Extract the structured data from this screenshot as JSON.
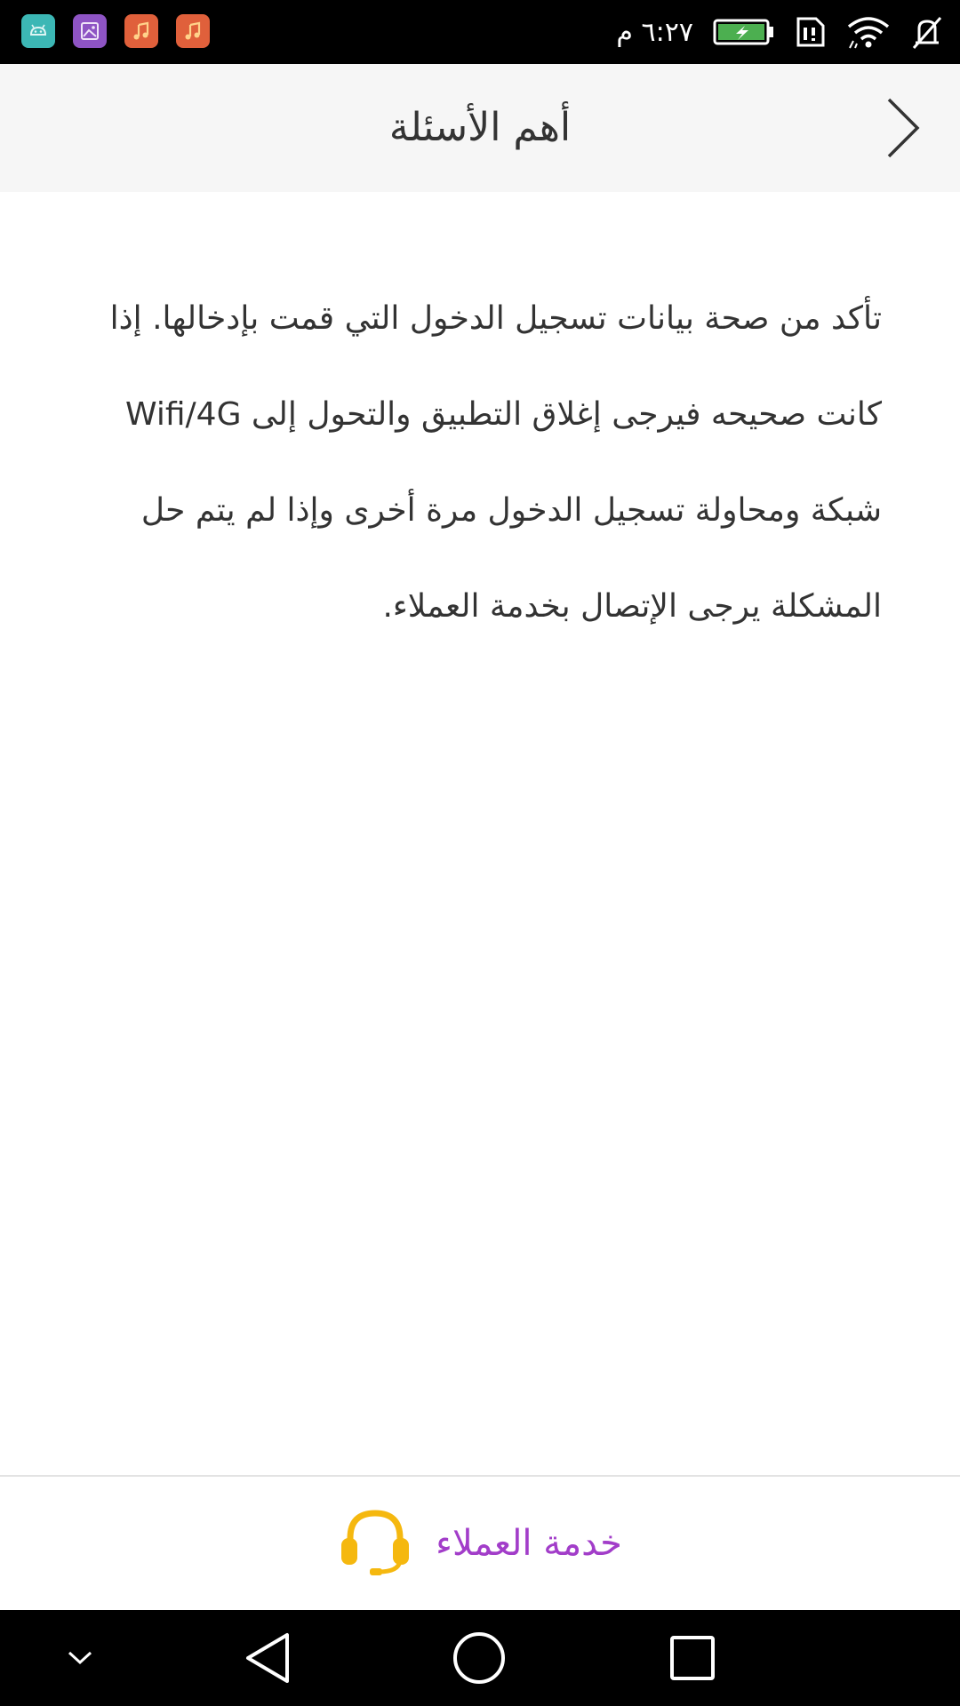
{
  "status_bar": {
    "time": "٦:٢٧ م",
    "notification_icons": [
      "android-icon",
      "gallery-icon",
      "music-icon",
      "music-icon"
    ],
    "status_icons": [
      "mute-icon",
      "wifi-icon",
      "sim-icon",
      "battery-icon"
    ],
    "battery_color": "#4caf50"
  },
  "header": {
    "title": "أهم الأسئلة"
  },
  "content": {
    "answer": "تأكد من صحة بيانات تسجيل الدخول التي قمت بإدخالها. إذا كانت صحيحه فيرجى إغلاق التطبيق والتحول إلى Wifi/4G شبكة ومحاولة تسجيل الدخول مرة أخرى وإذا لم يتم حل المشكلة يرجى الإتصال بخدمة العملاء."
  },
  "bottom_bar": {
    "service_label": "خدمة العملاء",
    "icon": "headset-icon",
    "icon_color": "#f5b80f",
    "label_color": "#a23dc9"
  },
  "nav_bar": {
    "buttons": [
      "collapse-icon",
      "back-icon",
      "home-icon",
      "recents-icon"
    ]
  }
}
